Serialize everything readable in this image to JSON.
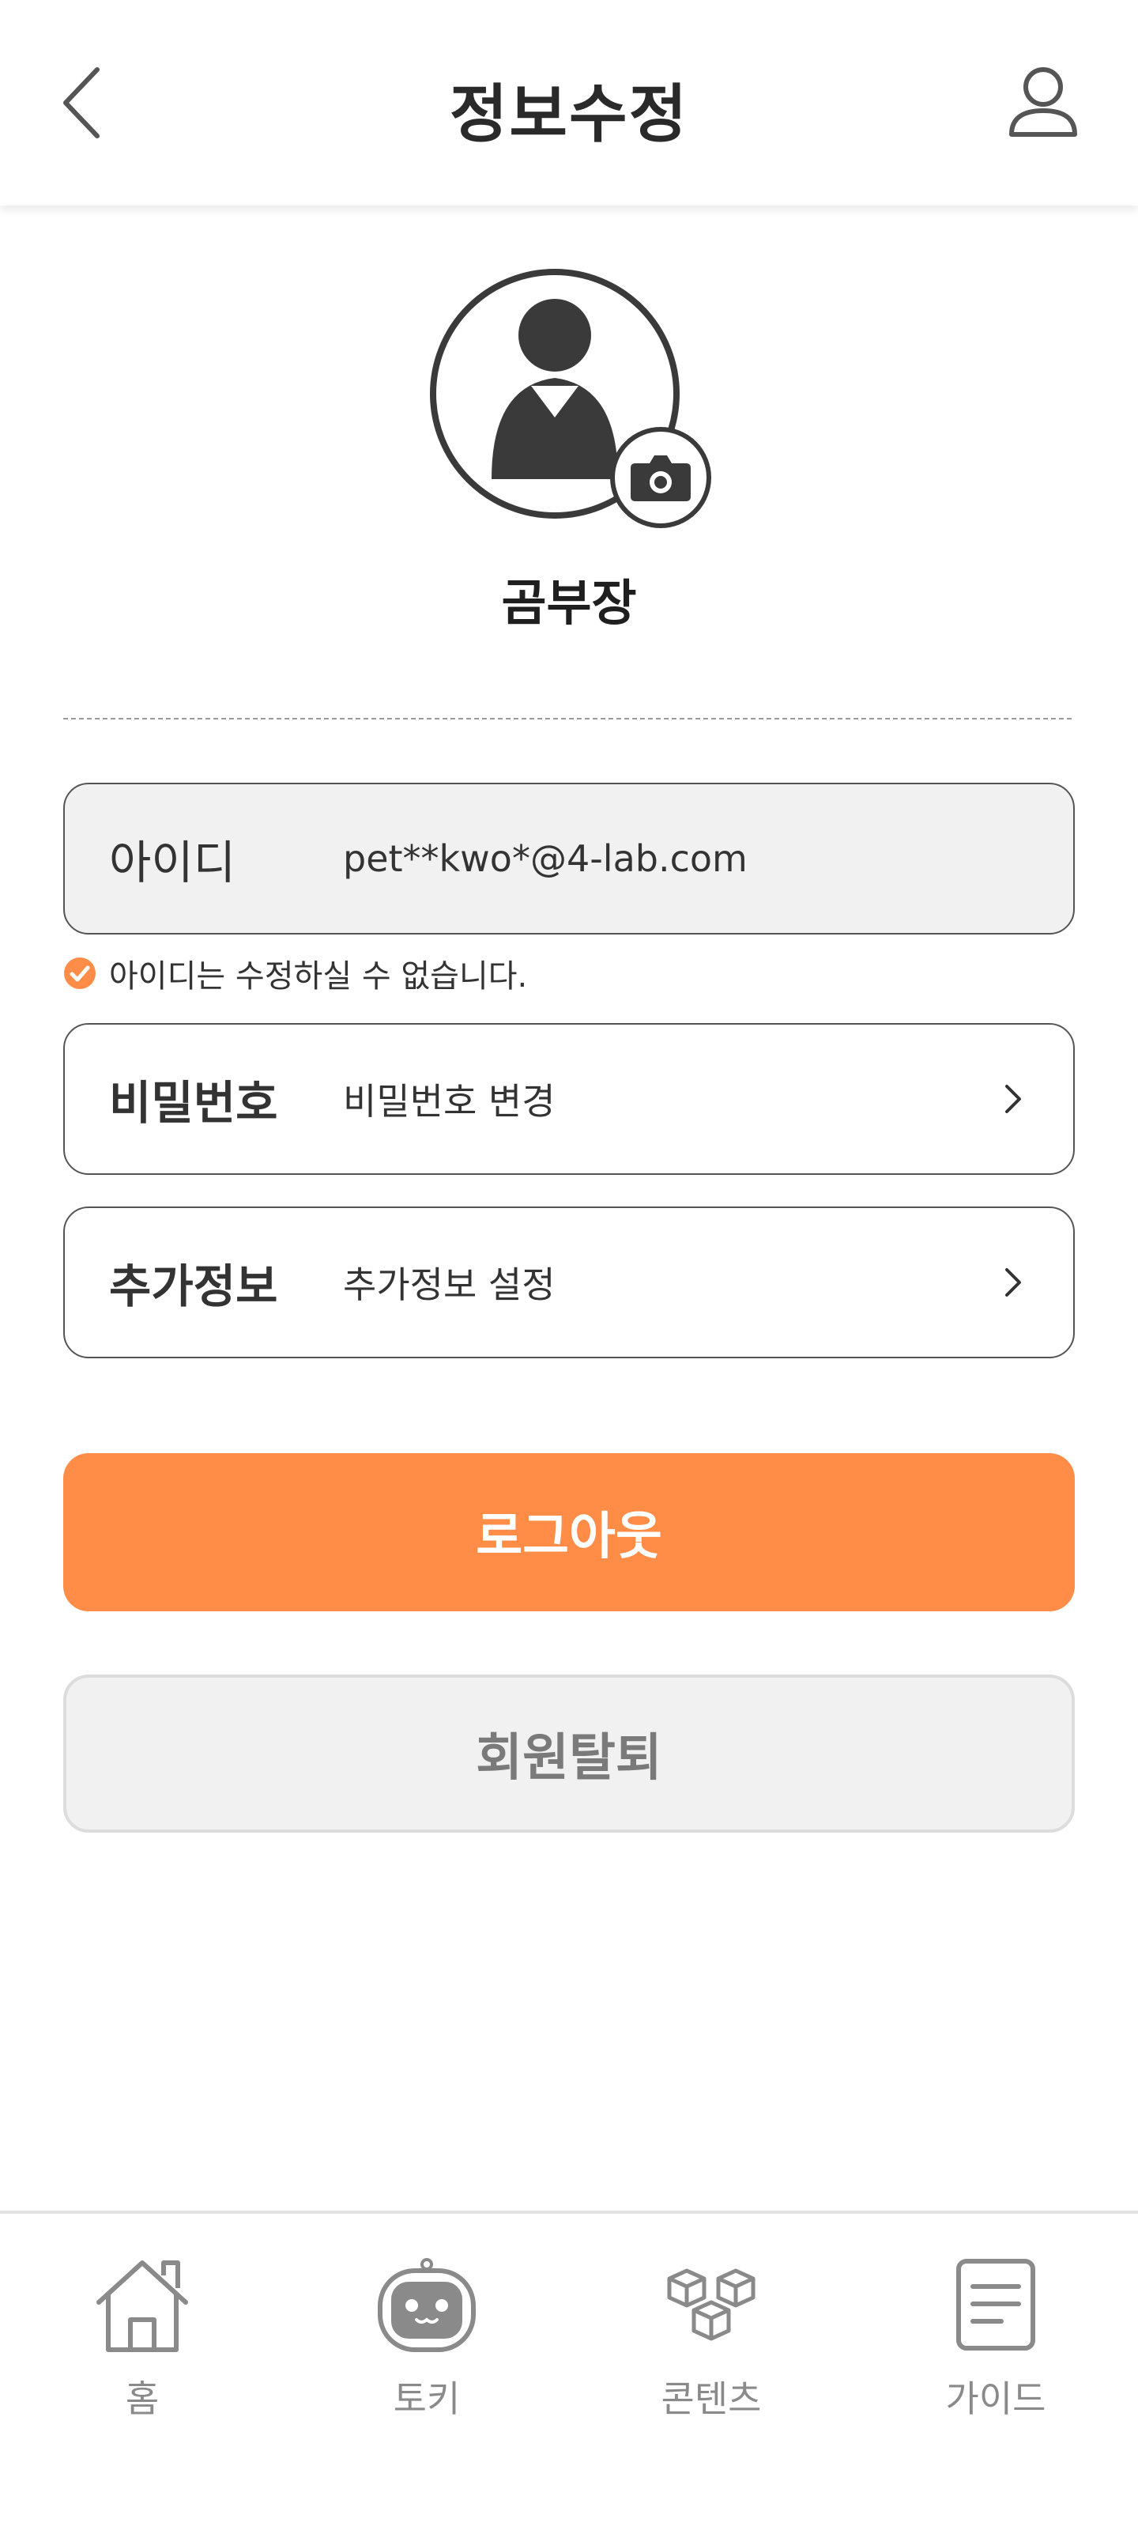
{
  "header": {
    "title": "정보수정",
    "back_icon": "chevron-left-icon",
    "user_icon": "user-icon"
  },
  "profile": {
    "nickname": "곰부장",
    "avatar_icon": "avatar-icon",
    "camera_icon": "camera-icon"
  },
  "fields": {
    "id": {
      "label": "아이디",
      "value": "pet**kwo*@4-lab.com"
    },
    "id_note": "아이디는 수정하실 수 없습니다.",
    "password": {
      "label": "비밀번호",
      "value": "비밀번호 변경"
    },
    "extra": {
      "label": "추가정보",
      "value": "추가정보 설정"
    }
  },
  "buttons": {
    "logout": "로그아웃",
    "withdraw": "회원탈퇴"
  },
  "bottom_nav": {
    "items": [
      {
        "label": "홈",
        "icon": "home-icon"
      },
      {
        "label": "토키",
        "icon": "robot-icon"
      },
      {
        "label": "콘텐츠",
        "icon": "cubes-icon"
      },
      {
        "label": "가이드",
        "icon": "document-icon"
      }
    ]
  },
  "colors": {
    "accent": "#ff8c47",
    "text": "#333333",
    "muted": "#8a8a8a",
    "readonly_bg": "#f1f1f1"
  }
}
